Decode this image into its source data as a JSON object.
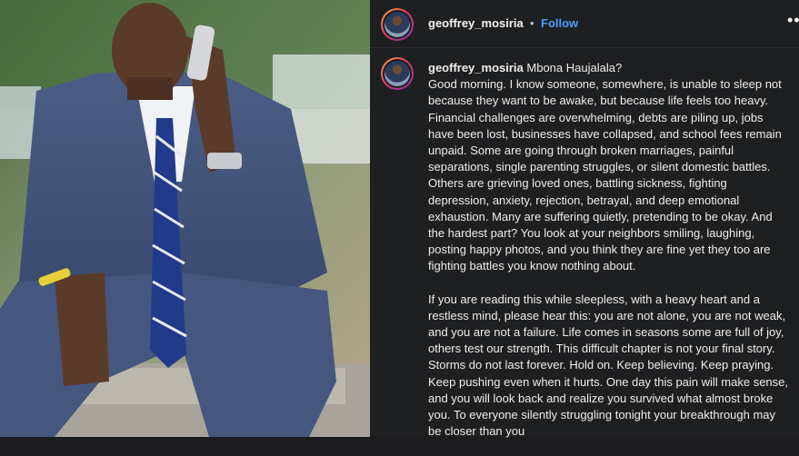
{
  "post": {
    "username": "geoffrey_mosiria",
    "separator": "•",
    "follow_label": "Follow",
    "more_icon": "more-horizontal-icon",
    "caption_title": "Mbona Haujalala?",
    "paragraphs": [
      "Good morning. I know someone, somewhere, is unable to sleep not because they want to be awake, but because life feels too heavy. Financial challenges are overwhelming, debts are piling up, jobs have been lost, businesses have collapsed, and school fees remain unpaid. Some are going through broken marriages, painful separations, single parenting struggles, or silent domestic battles. Others are grieving loved ones, battling sickness, fighting depression, anxiety, rejection, betrayal, and deep emotional exhaustion. Many are suffering quietly, pretending to be okay. And the hardest part? You look at your neighbors smiling, laughing, posting happy photos, and you think they are fine yet they too are fighting battles you know nothing about.",
      "If you are reading this while sleepless, with a heavy heart and a restless mind, please hear this: you are not alone, you are not weak, and you are not a failure. Life comes in seasons some are full of joy, others test our strength. This difficult chapter is not your final story. Storms do not last forever. Hold on. Keep believing. Keep praying. Keep pushing even when it hurts. One day this pain will make sense, and you will look back and realize you survived what almost broke you. To everyone silently struggling tonight your breakthrough may be closer than you"
    ]
  },
  "colors": {
    "panel_bg": "#1e1f21",
    "follow": "#4a9eff",
    "text": "#ededed"
  }
}
